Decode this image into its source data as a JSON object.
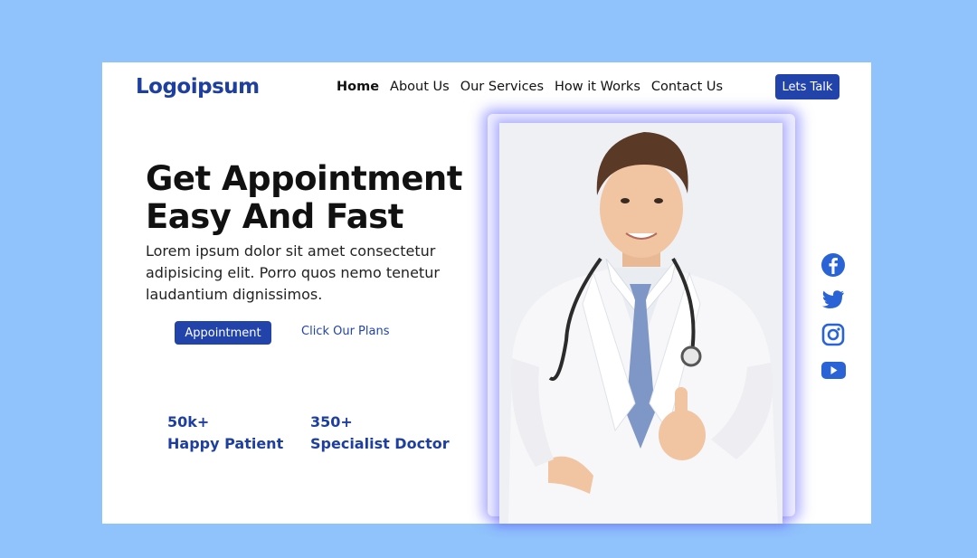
{
  "brand": {
    "logo_text": "Logoipsum"
  },
  "nav": {
    "items": [
      {
        "label": "Home",
        "active": true
      },
      {
        "label": "About Us"
      },
      {
        "label": "Our Services"
      },
      {
        "label": "How it Works"
      },
      {
        "label": "Contact Us"
      }
    ],
    "cta_label": "Lets Talk"
  },
  "hero": {
    "title_line1": "Get Appointment",
    "title_line2": "Easy And Fast",
    "body": "Lorem ipsum dolor sit amet consectetur adipisicing elit. Porro quos nemo tenetur laudantium dignissimos.",
    "primary_button": "Appointment",
    "secondary_link": "Click Our Plans"
  },
  "stats": [
    {
      "value": "50k+",
      "label": "Happy Patient"
    },
    {
      "value": "350+",
      "label": "Specialist Doctor"
    }
  ],
  "socials": [
    "facebook-icon",
    "twitter-icon",
    "instagram-icon",
    "youtube-icon"
  ],
  "colors": {
    "background": "#90c2fb",
    "brand": "#1f3fa0",
    "button": "#2244aa",
    "social": "#2a63d6"
  }
}
